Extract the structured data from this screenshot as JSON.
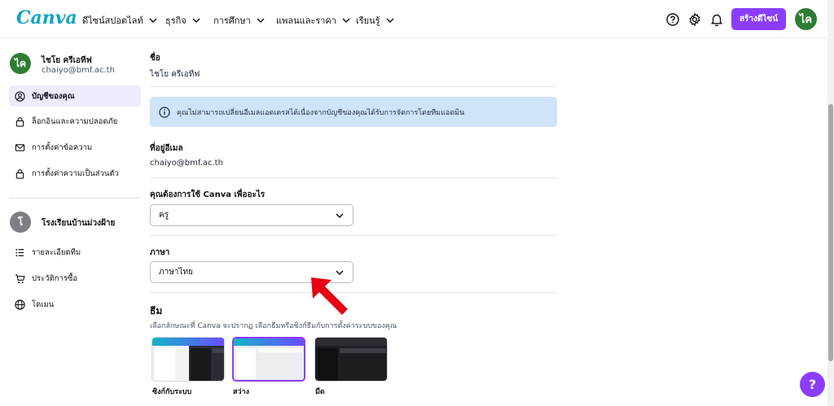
{
  "app": {
    "logo": "Canva"
  },
  "topnav": {
    "items": [
      {
        "label": "ดีไซน์สปอตไลท์"
      },
      {
        "label": "ธุรกิจ"
      },
      {
        "label": "การศึกษา"
      },
      {
        "label": "แพลนและราคา"
      },
      {
        "label": "เรียนรู้"
      }
    ],
    "create_button": "สร้างดีไซน์",
    "avatar_initials": "ไค"
  },
  "sidebar": {
    "user": {
      "initials": "ไค",
      "name": "ไชโย ครีเอทีฟ",
      "email": "chaiyo@bmf.ac.th"
    },
    "account_items": [
      {
        "label": "บัญชีของคุณ",
        "icon": "user-circle-icon",
        "active": true
      },
      {
        "label": "ล็อกอินและความปลอดภัย",
        "icon": "lock-icon"
      },
      {
        "label": "การตั้งค่าข้อความ",
        "icon": "mail-icon"
      },
      {
        "label": "การตั้งค่าความเป็นส่วนตัว",
        "icon": "lock-icon"
      }
    ],
    "team": {
      "initial": "โ",
      "name": "โรงเรียนบ้านม่วงฝ้าย"
    },
    "team_items": [
      {
        "label": "รายละเอียดทีม",
        "icon": "list-icon"
      },
      {
        "label": "ประวัติการซื้อ",
        "icon": "cart-icon"
      },
      {
        "label": "โดเมน",
        "icon": "globe-icon"
      }
    ]
  },
  "main": {
    "name": {
      "label": "ชื่อ",
      "value": "ไชโย ครีเอทีฟ"
    },
    "info_message": "คุณไม่สามารถเปลี่ยนอีเมลแอดเดรสได้เนื่องจากบัญชีของคุณได้รับการจัดการโดยทีมแอดมิน",
    "email": {
      "label": "ที่อยู่อีเมล",
      "value": "chaiyo@bmf.ac.th"
    },
    "purpose": {
      "label": "คุณต้องการใช้ Canva เพื่ออะไร",
      "value": "ครู"
    },
    "language": {
      "label": "ภาษา",
      "value": "ภาษาไทย"
    },
    "theme": {
      "title": "ธีม",
      "description": "เลือกลักษณะที่ Canva จะปรากฏ เลือกธีมหรือซิงก์ธีมกับการตั้งค่าระบบของคุณ",
      "options": [
        {
          "label": "ซิงก์กับระบบ"
        },
        {
          "label": "สว่าง",
          "selected": true
        },
        {
          "label": "มืด"
        }
      ]
    }
  },
  "help_button": "?",
  "colors": {
    "brand": "#8b3dff",
    "logo": "#13a3c2",
    "info_bg": "#cfe3fb",
    "annotation_arrow": "#e60012"
  }
}
